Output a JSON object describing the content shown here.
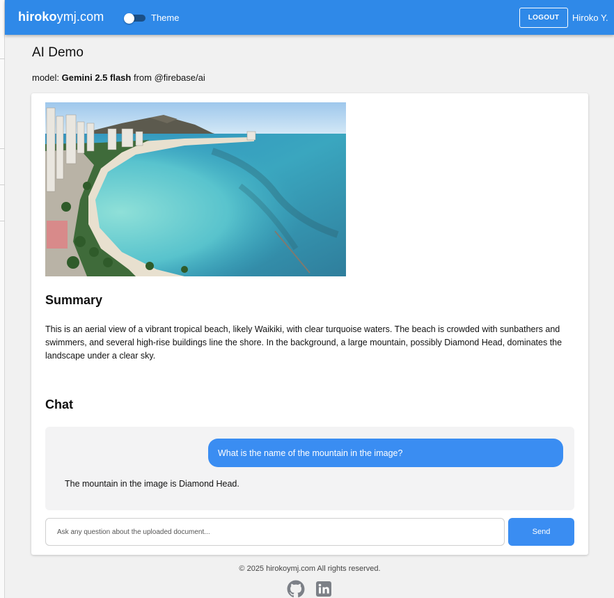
{
  "header": {
    "brand_bold": "hiroko",
    "brand_rest": "ymj.com",
    "theme_label": "Theme",
    "logout_label": "LOGOUT",
    "user_name": "Hiroko Y."
  },
  "page": {
    "title": "AI Demo",
    "model_prefix": "model: ",
    "model_name": "Gemini 2.5 flash",
    "model_suffix": " from @firebase/ai"
  },
  "summary": {
    "heading": "Summary",
    "text": "This is an aerial view of a vibrant tropical beach, likely Waikiki, with clear turquoise waters. The beach is crowded with sunbathers and swimmers, and several high-rise buildings line the shore. In the background, a large mountain, possibly Diamond Head, dominates the landscape under a clear sky."
  },
  "chat": {
    "heading": "Chat",
    "messages": [
      {
        "role": "user",
        "text": "What is the name of the mountain in the image?"
      },
      {
        "role": "ai",
        "text": "The mountain in the image is Diamond Head."
      }
    ],
    "input_placeholder": "Ask any question about the uploaded document...",
    "send_label": "Send"
  },
  "footer": {
    "copyright": "© 2025 hirokoymj.com All rights reserved.",
    "icons": [
      "github-icon",
      "linkedin-icon"
    ]
  },
  "colors": {
    "appbar": "#2f89e8",
    "accent": "#3a8df2",
    "background": "#f1f1f1"
  }
}
